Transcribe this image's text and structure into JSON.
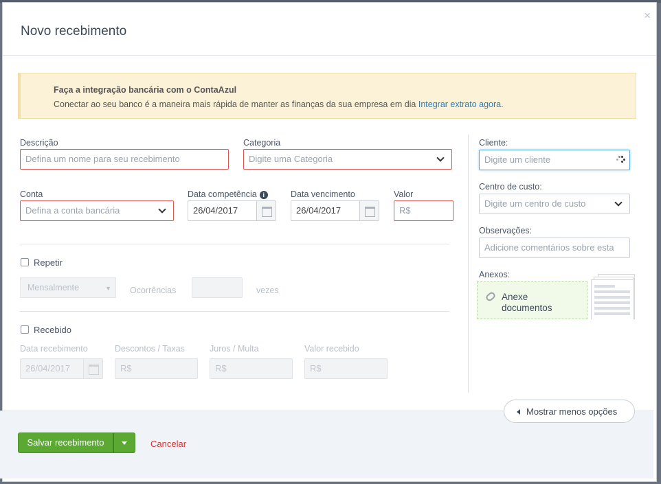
{
  "modal": {
    "title": "Novo recebimento",
    "close_label": "×"
  },
  "alert": {
    "title": "Faça a integração bancária com o ContaAzul",
    "text": "Conectar ao seu banco é a maneira mais rápida de manter as finanças da sua empresa em dia",
    "link": "Integrar extrato agora",
    "suffix": "."
  },
  "form": {
    "descricao": {
      "label": "Descrição",
      "placeholder": "Defina um nome para seu recebimento"
    },
    "categoria": {
      "label": "Categoria",
      "placeholder": "Digite uma Categoria"
    },
    "conta": {
      "label": "Conta",
      "placeholder": "Defina a conta bancária"
    },
    "data_competencia": {
      "label": "Data competência",
      "value": "26/04/2017"
    },
    "data_vencimento": {
      "label": "Data vencimento",
      "value": "26/04/2017"
    },
    "valor": {
      "label": "Valor",
      "placeholder": "R$"
    },
    "repetir": {
      "label": "Repetir",
      "frequency": "Mensalmente",
      "occurrences_label": "Ocorrências",
      "times_label": "vezes"
    },
    "recebido": {
      "label": "Recebido",
      "data_recebimento": {
        "label": "Data recebimento",
        "value": "26/04/2017"
      },
      "descontos": {
        "label": "Descontos / Taxas",
        "placeholder": "R$"
      },
      "juros": {
        "label": "Juros / Multa",
        "placeholder": "R$"
      },
      "valor_recebido": {
        "label": "Valor recebido",
        "placeholder": "R$"
      }
    }
  },
  "side": {
    "cliente": {
      "label": "Cliente:",
      "placeholder": "Digite um cliente"
    },
    "centro": {
      "label": "Centro de custo:",
      "placeholder": "Digite um centro de custo"
    },
    "obs": {
      "label": "Observações:",
      "placeholder": "Adicione comentários sobre esta"
    },
    "anexos": {
      "label": "Anexos:",
      "button": "Anexe documentos"
    }
  },
  "footer": {
    "more_options": "Mostrar menos opções",
    "save": "Salvar recebimento",
    "cancel": "Cancelar"
  },
  "colors": {
    "primary": "#5ba833",
    "error": "#d9534f",
    "link": "#2d7bb8",
    "alert_bg": "#fbf2d7"
  }
}
